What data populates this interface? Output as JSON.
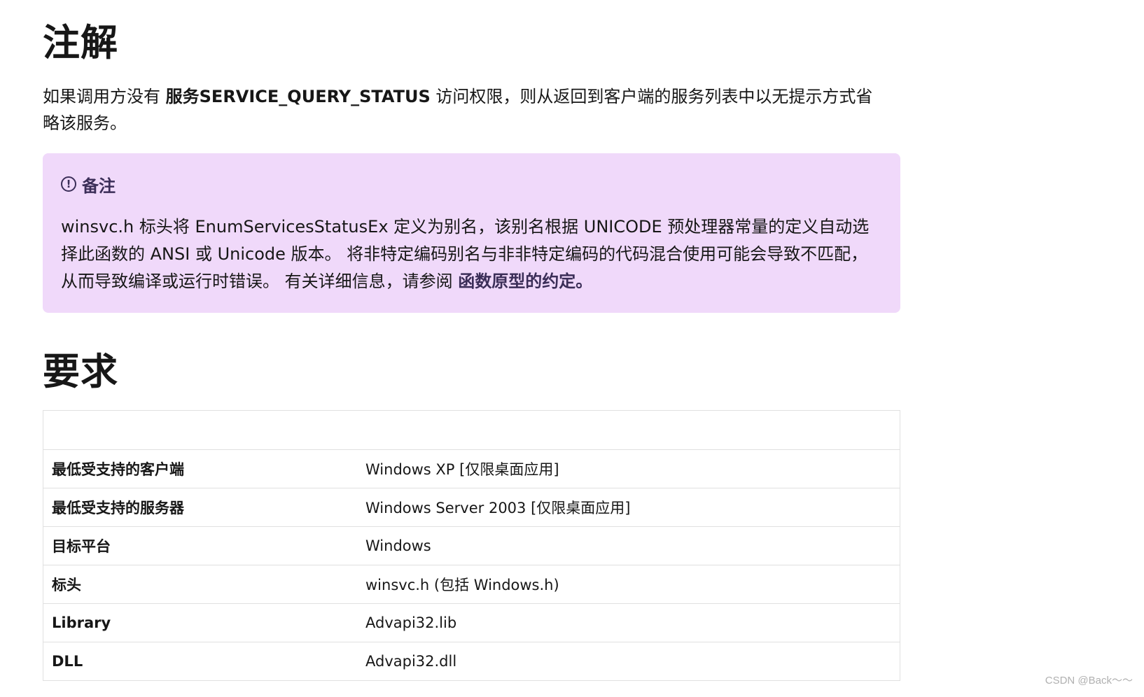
{
  "remarks": {
    "heading": "注解",
    "paragraph_prefix": "如果调用方没有 ",
    "paragraph_bold": "服务SERVICE_QUERY_STATUS",
    "paragraph_suffix": " 访问权限，则从返回到客户端的服务列表中以无提示方式省略该服务。"
  },
  "note": {
    "icon": "info-circle-icon",
    "title": "备注",
    "body_text": "winsvc.h 标头将 EnumServicesStatusEx 定义为别名，该别名根据 UNICODE 预处理器常量的定义自动选择此函数的 ANSI 或 Unicode 版本。 将非特定编码别名与非非特定编码的代码混合使用可能会导致不匹配，从而导致编译或运行时错误。 有关详细信息，请参阅 ",
    "link_text": "函数原型的约定。",
    "background_color": "#f0d9fa"
  },
  "requirements": {
    "heading": "要求",
    "rows": [
      {
        "key": "最低受支持的客户端",
        "value": "Windows XP [仅限桌面应用]"
      },
      {
        "key": "最低受支持的服务器",
        "value": "Windows Server 2003 [仅限桌面应用]"
      },
      {
        "key": "目标平台",
        "value": "Windows"
      },
      {
        "key": "标头",
        "value": "winsvc.h (包括 Windows.h)"
      },
      {
        "key": "Library",
        "value": "Advapi32.lib"
      },
      {
        "key": "DLL",
        "value": "Advapi32.dll"
      }
    ]
  },
  "watermark": "CSDN @Back～～"
}
